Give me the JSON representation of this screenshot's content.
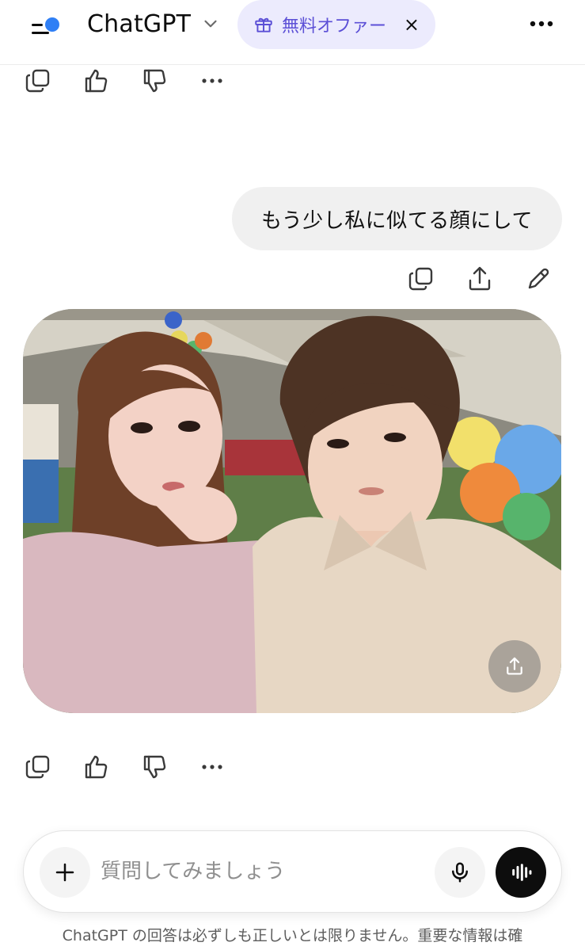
{
  "header": {
    "model_name": "ChatGPT",
    "offer_label": "無料オファー",
    "offer_close": "×"
  },
  "icons": {
    "copy": "copy-icon",
    "thumb_up": "thumbs-up-icon",
    "thumb_down": "thumbs-down-icon",
    "more": "more-icon",
    "share": "share-icon",
    "edit": "edit-icon",
    "gift": "gift-icon"
  },
  "conversation": {
    "user_message": "もう少し私に似てる顔にして"
  },
  "composer": {
    "placeholder": "質問してみましょう"
  },
  "footer": {
    "disclaimer": "ChatGPT の回答は必ずしも正しいとは限りません。重要な情報は確"
  },
  "colors": {
    "accent": "#2f7ff5",
    "offer_bg": "#ecebfd",
    "offer_text": "#5b4fd6",
    "bubble_bg": "#f0f0f0"
  }
}
